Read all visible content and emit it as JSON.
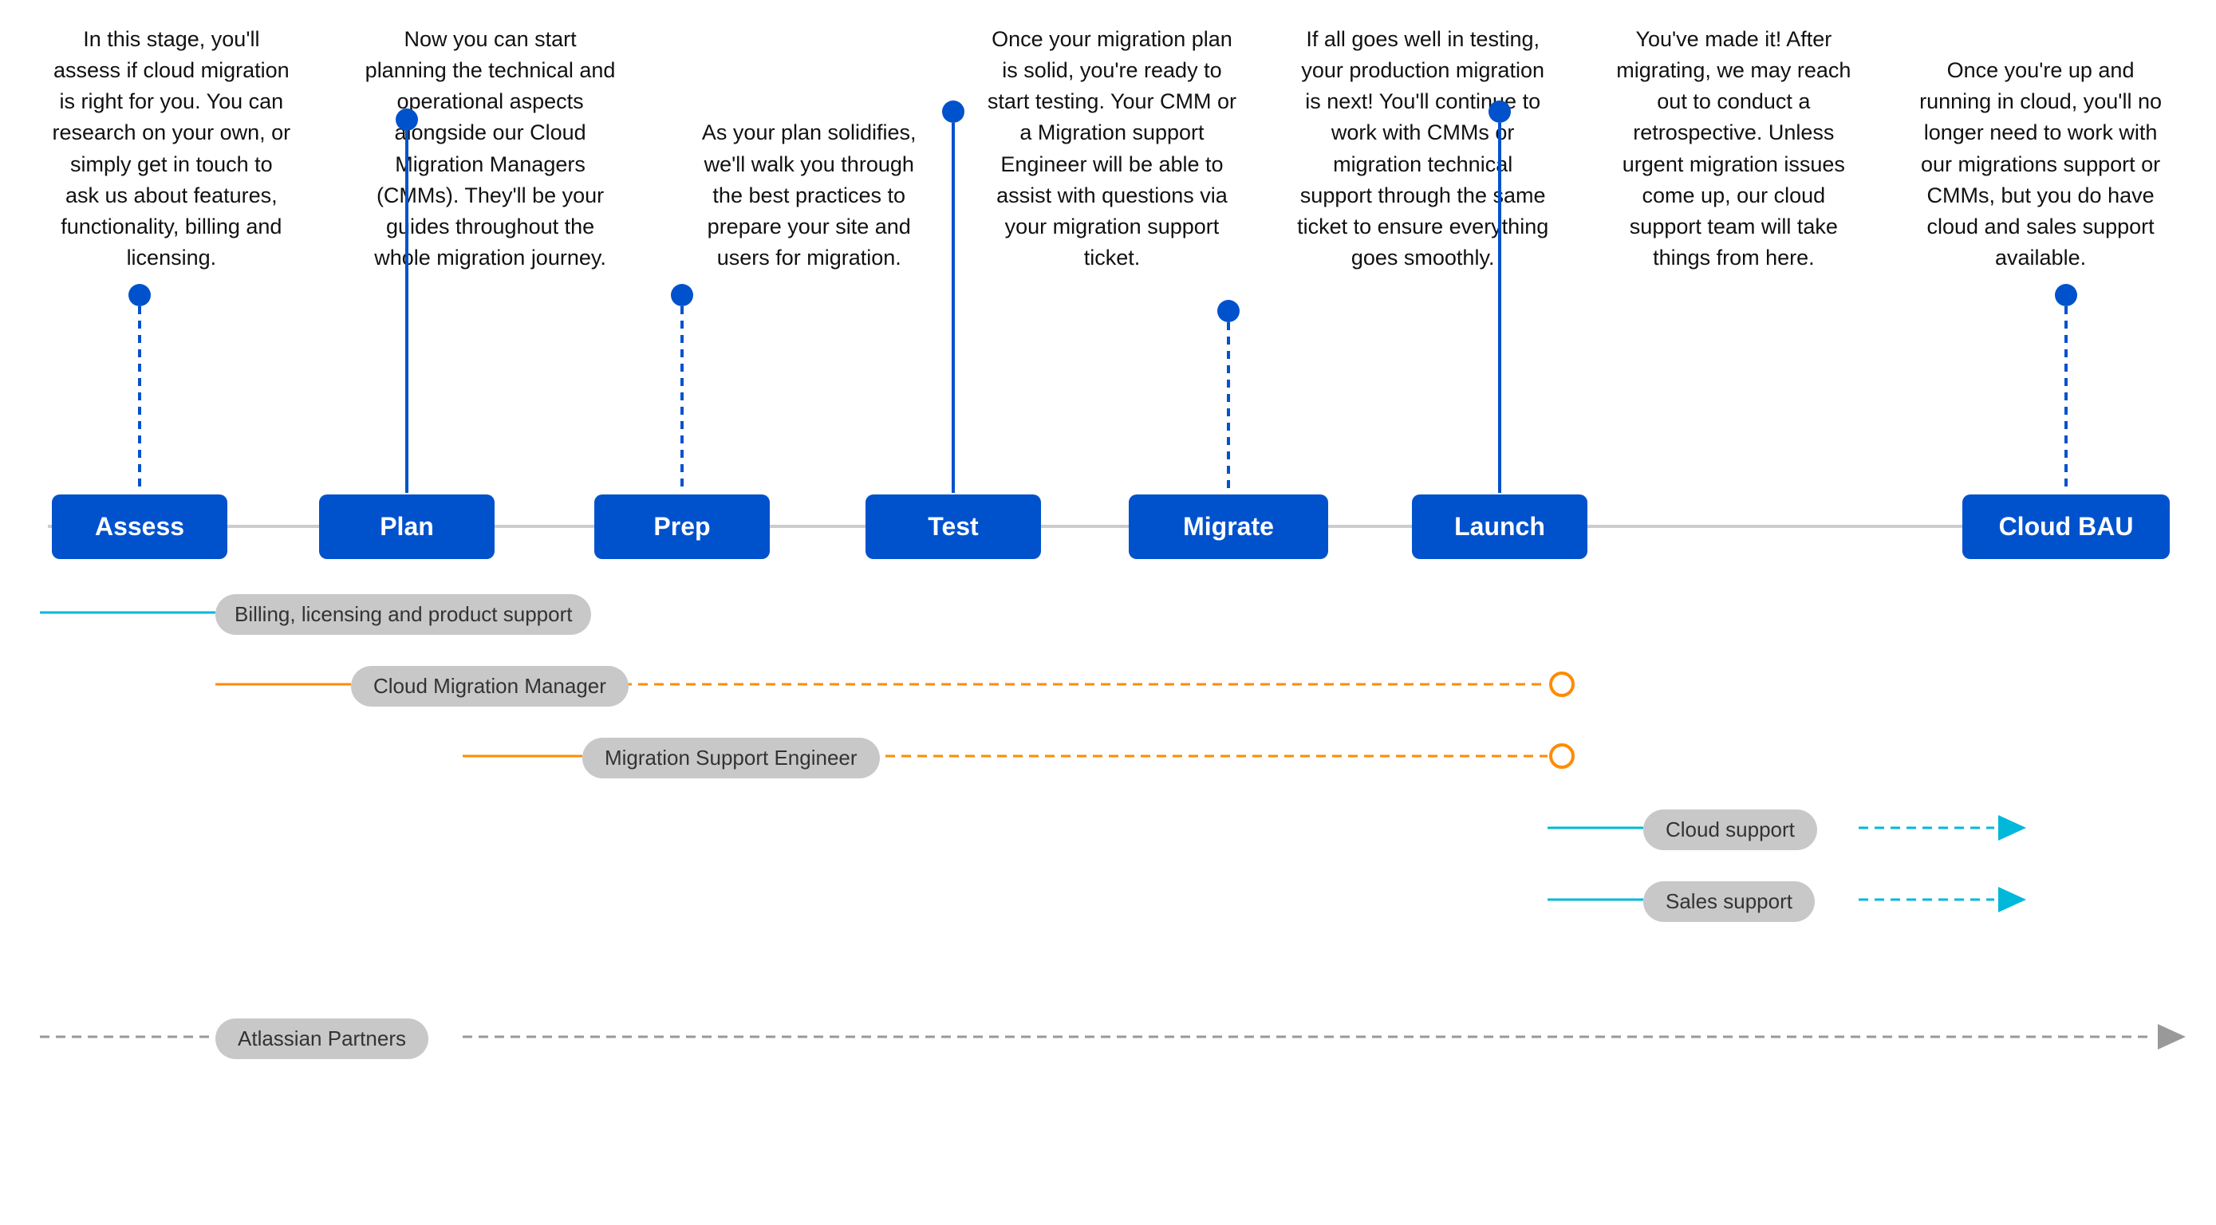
{
  "stages": [
    {
      "id": "assess",
      "label": "Assess",
      "description": "In this stage, you'll assess if cloud migration is right for you. You can research on your own, or simply get in touch to ask us about features, functionality, billing and licensing.",
      "connector_type": "down_solid_short"
    },
    {
      "id": "plan",
      "label": "Plan",
      "description": "Now you can start planning the technical and operational aspects alongside our Cloud Migration Managers (CMMs). They'll be your guides throughout the whole migration journey.",
      "connector_type": "up_solid_long"
    },
    {
      "id": "prep",
      "label": "Prep",
      "description": "As your plan solidifies, we'll walk you through the best practices to prepare your site and users for migration.",
      "connector_type": "down_solid_short"
    },
    {
      "id": "test",
      "label": "Test",
      "description": "Once your migration plan is solid, you're ready to start testing. Your CMM or a Migration support Engineer will be able to assist with questions via your migration support ticket.",
      "connector_type": "up_solid_long"
    },
    {
      "id": "migrate",
      "label": "Migrate",
      "description": "If all goes well in testing, your production migration is next! You'll continue to work with CMMs or migration technical support through the same ticket to ensure everything goes smoothly.",
      "connector_type": "down_solid_short"
    },
    {
      "id": "launch",
      "label": "Launch",
      "description": "You've made it! After migrating, we may reach out to conduct a retrospective. Unless urgent migration issues come up, our cloud support team will take things from here.",
      "connector_type": "up_solid_long"
    },
    {
      "id": "cloud-bau",
      "label": "Cloud BAU",
      "description": "Once you're up and running in cloud, you'll no longer need to work with our migrations support or CMMs, but you do have cloud and sales support available.",
      "connector_type": "down_solid_short"
    }
  ],
  "support_rows": [
    {
      "id": "billing",
      "label": "Billing, licensing and product support",
      "type": "teal_short",
      "end": "circle"
    },
    {
      "id": "cmm",
      "label": "Cloud Migration Manager",
      "type": "orange_long",
      "end": "circle"
    },
    {
      "id": "mse",
      "label": "Migration Support Engineer",
      "type": "orange_medium",
      "end": "circle"
    },
    {
      "id": "cloud-support",
      "label": "Cloud support",
      "type": "teal_short_right",
      "end": "arrow"
    },
    {
      "id": "sales-support",
      "label": "Sales support",
      "type": "teal_short_right",
      "end": "arrow"
    },
    {
      "id": "atlassian-partners",
      "label": "Atlassian Partners",
      "type": "gray_full",
      "end": "arrow"
    }
  ],
  "colors": {
    "stage_bg": "#0052CC",
    "stage_text": "#ffffff",
    "timeline": "#cccccc",
    "dot": "#0052CC",
    "teal": "#00B8D9",
    "orange": "#FF8B00",
    "gray": "#999999",
    "label_bg": "#c8c8c8",
    "label_text": "#333333"
  }
}
